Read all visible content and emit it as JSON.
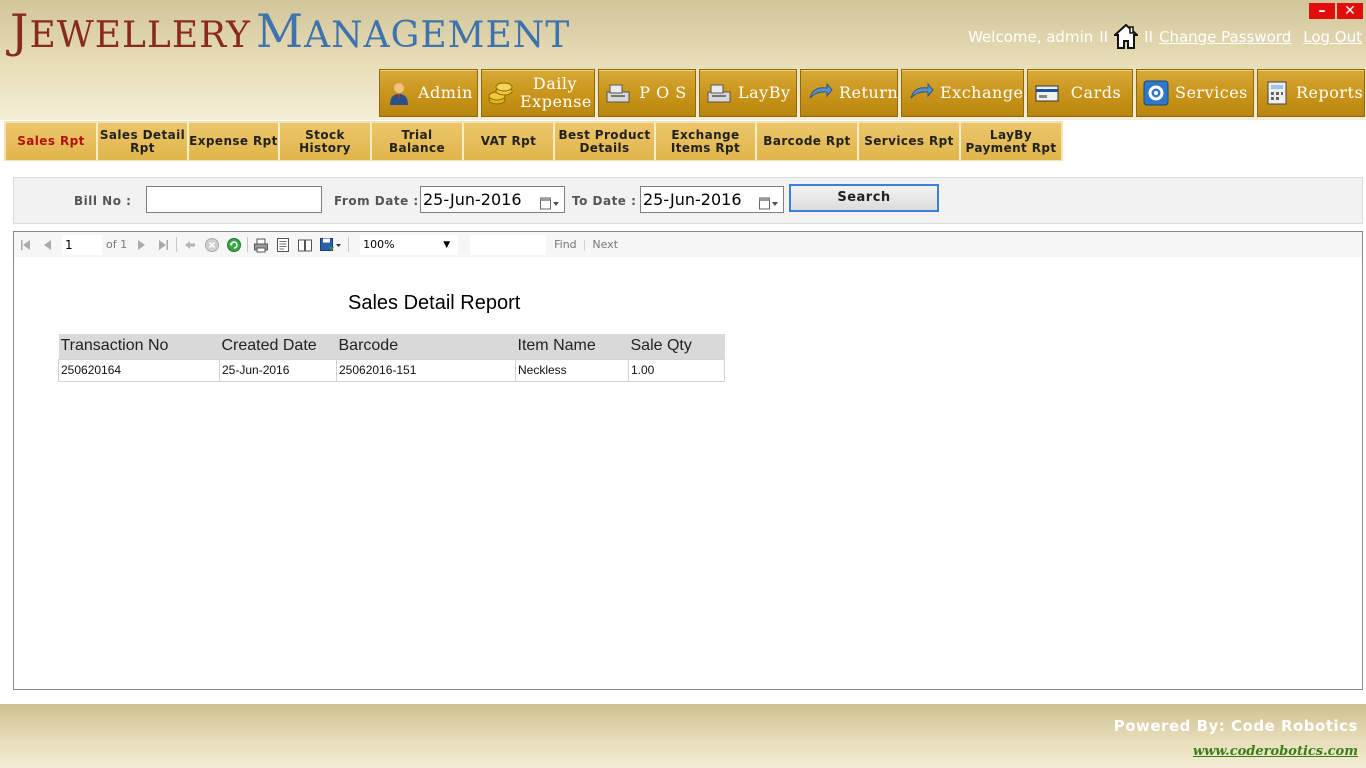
{
  "app": {
    "logo_part1_initial": "J",
    "logo_part1_rest": "EWELLERY",
    "logo_part2_initial": "M",
    "logo_part2_rest": "ANAGEMENT"
  },
  "window": {
    "minimize": "–",
    "close": "✕"
  },
  "topbar": {
    "welcome": "Welcome, admin",
    "separator": "II",
    "change_password": "Change Password",
    "logout": "Log Out"
  },
  "mainnav": [
    {
      "label": "Admin",
      "icon": "admin-icon"
    },
    {
      "label": "Daily Expense",
      "icon": "coins-icon"
    },
    {
      "label": "P O S",
      "icon": "cash-register-icon"
    },
    {
      "label": "LayBy",
      "icon": "cash-register-icon"
    },
    {
      "label": "Return",
      "icon": "return-arrow-icon"
    },
    {
      "label": "Exchange",
      "icon": "exchange-arrow-icon"
    },
    {
      "label": "Cards",
      "icon": "card-reader-icon"
    },
    {
      "label": "Services",
      "icon": "services-gear-icon"
    },
    {
      "label": "Reports",
      "icon": "calculator-icon"
    }
  ],
  "subtabs": [
    {
      "label": "Sales Rpt"
    },
    {
      "label": "Sales Detail Rpt"
    },
    {
      "label": "Expense Rpt"
    },
    {
      "label": "Stock History"
    },
    {
      "label": "Trial Balance"
    },
    {
      "label": "VAT Rpt"
    },
    {
      "label": "Best Product Details"
    },
    {
      "label": "Exchange Items Rpt"
    },
    {
      "label": "Barcode Rpt"
    },
    {
      "label": "Services Rpt"
    },
    {
      "label": "LayBy Payment Rpt"
    }
  ],
  "search": {
    "bill_no_label": "Bill No :",
    "bill_no_value": "",
    "from_date_label": "From Date :",
    "from_date_value": "25-Jun-2016",
    "to_date_label": "To Date :",
    "to_date_value": "25-Jun-2016",
    "search_button": "Search"
  },
  "report_toolbar": {
    "page_current": "1",
    "page_of": "of 1",
    "zoom": "100%",
    "find": "Find",
    "next": "Next"
  },
  "report": {
    "title": "Sales Detail Report",
    "columns": [
      "Transaction No",
      "Created Date",
      "Barcode",
      "Item Name",
      "Sale Qty"
    ],
    "rows": [
      [
        "250620164",
        "25-Jun-2016",
        "25062016-151",
        "Neckless",
        "1.00"
      ]
    ]
  },
  "footer": {
    "powered_by": "Powered By: Code Robotics",
    "website": "www.coderobotics.com"
  },
  "colors": {
    "nav_gold": "#c79217",
    "subtab_gold": "#e0b54b",
    "active_tab_text": "#b01212",
    "logo_red": "#8a2a1e",
    "logo_blue": "#3f73ad",
    "link_green": "#3b7d17"
  }
}
